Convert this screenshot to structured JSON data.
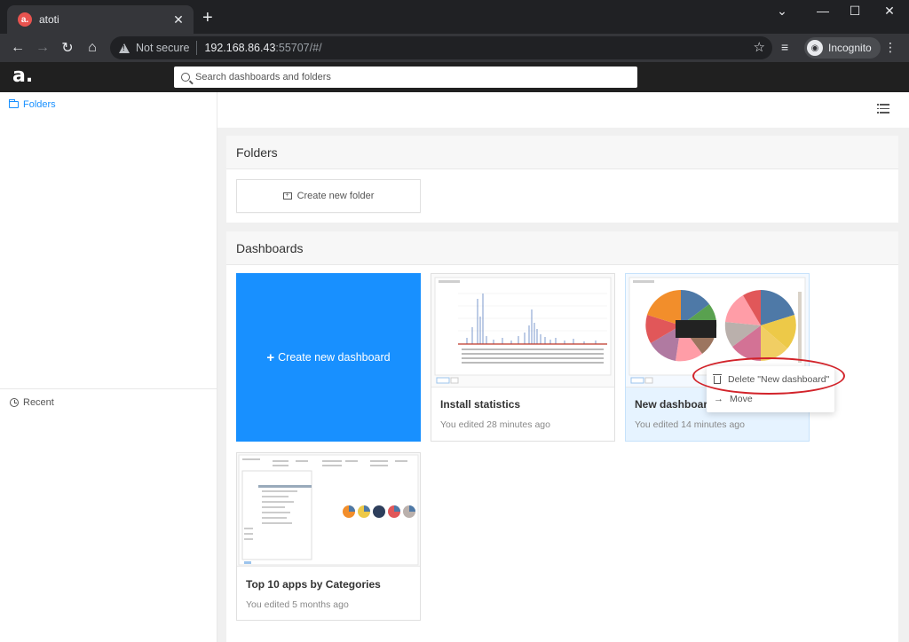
{
  "browser": {
    "tab_title": "atoti",
    "tab_favicon": "a.",
    "new_tab": "+",
    "win_minimize": "⌄",
    "security_label": "Not secure",
    "url_host": "192.168.86.43",
    "url_rest": ":55707/#/",
    "profile_label": "Incognito",
    "icons": [
      "back-arrow-icon",
      "forward-arrow-icon",
      "reload-icon",
      "home-icon",
      "warning-icon",
      "star-icon",
      "media-queue-icon",
      "incognito-icon",
      "menu-dots-icon"
    ]
  },
  "app": {
    "logo": "a.",
    "search_placeholder": "Search dashboards and folders"
  },
  "sidebar": {
    "folders_label": "Folders",
    "recent_label": "Recent"
  },
  "folders_section": {
    "title": "Folders",
    "create_label": "Create new folder"
  },
  "dashboards_section": {
    "title": "Dashboards",
    "create_label": "Create new dashboard",
    "cards": [
      {
        "title": "Install statistics",
        "subtitle": "You edited 28 minutes ago"
      },
      {
        "title": "New dashboard",
        "subtitle": "You edited 14 minutes ago"
      },
      {
        "title": "Top 10 apps by Categories",
        "subtitle": "You edited 5 months ago"
      }
    ]
  },
  "context_menu": {
    "delete_label": "Delete \"New dashboard\"",
    "move_label": "Move"
  },
  "colors": {
    "accent": "#1890ff",
    "header_bg": "#202020",
    "highlight": "#d2232a"
  }
}
